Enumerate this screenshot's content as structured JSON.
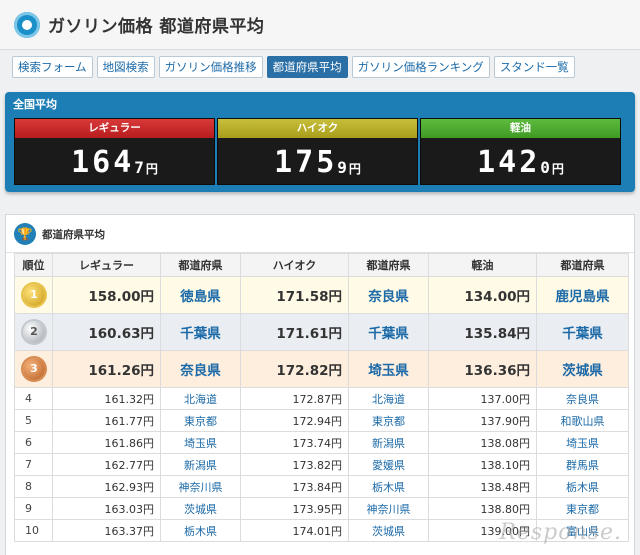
{
  "header": {
    "title": "ガソリン価格 都道府県平均"
  },
  "nav": {
    "tabs": [
      {
        "label": "検索フォーム",
        "active": false
      },
      {
        "label": "地図検索",
        "active": false
      },
      {
        "label": "ガソリン価格推移",
        "active": false
      },
      {
        "label": "都道府県平均",
        "active": true
      },
      {
        "label": "ガソリン価格ランキング",
        "active": false
      },
      {
        "label": "スタンド一覧",
        "active": false
      }
    ]
  },
  "national": {
    "label": "全国平均",
    "gauges": [
      {
        "name": "レギュラー",
        "int": "164",
        "dec": "7",
        "unit": "円",
        "color": "#c62828"
      },
      {
        "name": "ハイオク",
        "int": "175",
        "dec": "9",
        "unit": "円",
        "color": "#b3a923"
      },
      {
        "name": "軽油",
        "int": "142",
        "dec": "0",
        "unit": "円",
        "color": "#4caf30"
      }
    ]
  },
  "ranking": {
    "title": "都道府県平均",
    "headers": [
      "順位",
      "レギュラー",
      "都道府県",
      "ハイオク",
      "都道府県",
      "軽油",
      "都道府県"
    ],
    "rows": [
      {
        "rank": "1",
        "reg": "158.00円",
        "reg_pref": "徳島県",
        "high": "171.58円",
        "high_pref": "奈良県",
        "diesel": "134.00円",
        "diesel_pref": "鹿児島県"
      },
      {
        "rank": "2",
        "reg": "160.63円",
        "reg_pref": "千葉県",
        "high": "171.61円",
        "high_pref": "千葉県",
        "diesel": "135.84円",
        "diesel_pref": "千葉県"
      },
      {
        "rank": "3",
        "reg": "161.26円",
        "reg_pref": "奈良県",
        "high": "172.82円",
        "high_pref": "埼玉県",
        "diesel": "136.36円",
        "diesel_pref": "茨城県"
      },
      {
        "rank": "4",
        "reg": "161.32円",
        "reg_pref": "北海道",
        "high": "172.87円",
        "high_pref": "北海道",
        "diesel": "137.00円",
        "diesel_pref": "奈良県"
      },
      {
        "rank": "5",
        "reg": "161.77円",
        "reg_pref": "東京都",
        "high": "172.94円",
        "high_pref": "東京都",
        "diesel": "137.90円",
        "diesel_pref": "和歌山県"
      },
      {
        "rank": "6",
        "reg": "161.86円",
        "reg_pref": "埼玉県",
        "high": "173.74円",
        "high_pref": "新潟県",
        "diesel": "138.08円",
        "diesel_pref": "埼玉県"
      },
      {
        "rank": "7",
        "reg": "162.77円",
        "reg_pref": "新潟県",
        "high": "173.82円",
        "high_pref": "愛媛県",
        "diesel": "138.10円",
        "diesel_pref": "群馬県"
      },
      {
        "rank": "8",
        "reg": "162.93円",
        "reg_pref": "神奈川県",
        "high": "173.84円",
        "high_pref": "栃木県",
        "diesel": "138.48円",
        "diesel_pref": "栃木県"
      },
      {
        "rank": "9",
        "reg": "163.03円",
        "reg_pref": "茨城県",
        "high": "173.95円",
        "high_pref": "神奈川県",
        "diesel": "138.80円",
        "diesel_pref": "東京都"
      },
      {
        "rank": "10",
        "reg": "163.37円",
        "reg_pref": "栃木県",
        "high": "174.01円",
        "high_pref": "茨城県",
        "diesel": "139.00円",
        "diesel_pref": "富山県"
      }
    ]
  },
  "watermark": "Response."
}
